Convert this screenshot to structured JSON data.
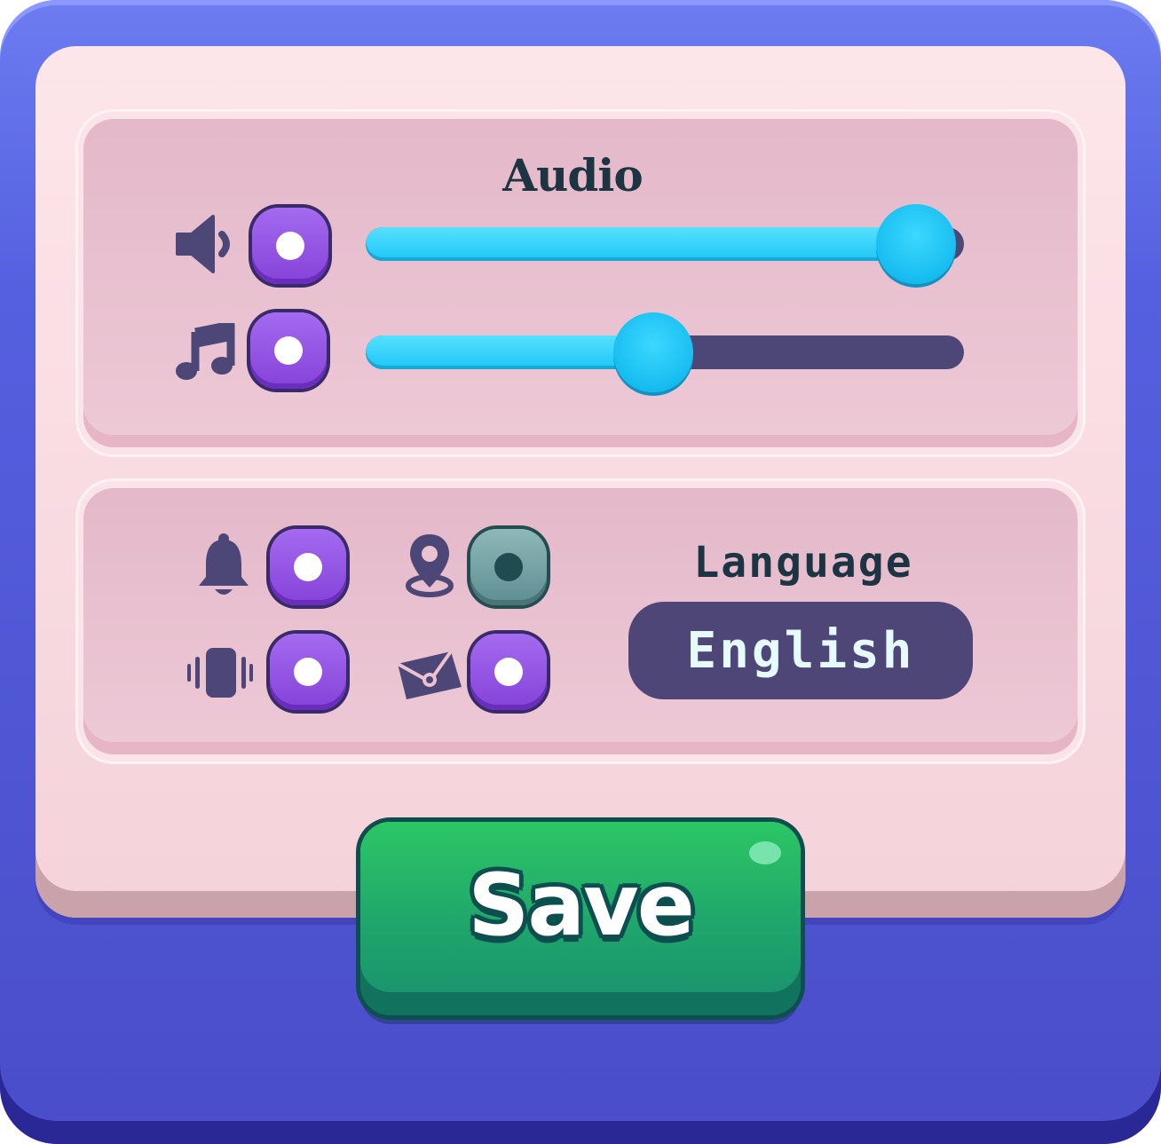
{
  "audio": {
    "title": "Audio",
    "sound": {
      "icon": "speaker-icon",
      "enabled": true,
      "level": 0.92
    },
    "music": {
      "icon": "music-note-icon",
      "enabled": true,
      "level": 0.48
    }
  },
  "settings": {
    "notifications": {
      "icon": "bell-icon",
      "enabled": true
    },
    "location": {
      "icon": "location-pin-icon",
      "enabled": false
    },
    "vibration": {
      "icon": "vibration-icon",
      "enabled": true
    },
    "messages": {
      "icon": "envelope-icon",
      "enabled": true
    }
  },
  "language": {
    "label": "Language",
    "value": "English"
  },
  "save": {
    "label": "Save"
  },
  "colors": {
    "frame": "#5560e0",
    "panel": "#fde6ea",
    "toggle_on": "#8542d8",
    "toggle_off": "#5d8d92",
    "slider_fill": "#1ec6f7",
    "slider_track": "#4c4777",
    "save_button": "#1fa56c",
    "text_dark": "#1d3442"
  }
}
